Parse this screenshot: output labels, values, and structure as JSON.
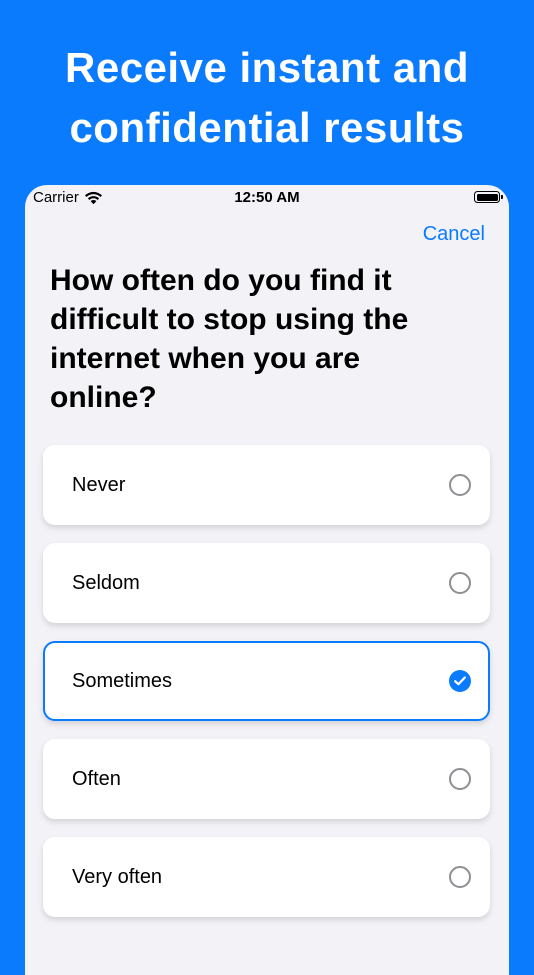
{
  "promo": {
    "line1": "Receive instant and",
    "line2": "confidential results"
  },
  "status_bar": {
    "carrier": "Carrier",
    "time": "12:50 AM",
    "icons": [
      "wifi-icon",
      "battery-icon"
    ]
  },
  "nav": {
    "cancel_label": "Cancel"
  },
  "question": {
    "text": "How often do you find it difficult to stop using the internet when you are online?"
  },
  "options": [
    {
      "label": "Never",
      "selected": false
    },
    {
      "label": "Seldom",
      "selected": false
    },
    {
      "label": "Sometimes",
      "selected": true
    },
    {
      "label": "Often",
      "selected": false
    },
    {
      "label": "Very often",
      "selected": false
    }
  ],
  "colors": {
    "accent": "#0a7bfd",
    "background": "#f2f2f7",
    "card": "#ffffff",
    "radio_unselected": "#8e8e93"
  }
}
